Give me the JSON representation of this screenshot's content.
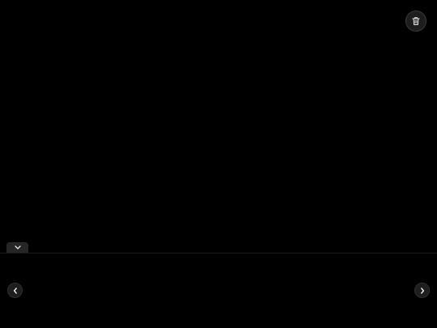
{
  "viewer": {
    "background": "#000000",
    "icons": {
      "delete": "trash-icon",
      "collapse": "chevron-down-icon",
      "previous": "chevron-left-icon",
      "next": "chevron-right-icon"
    }
  }
}
